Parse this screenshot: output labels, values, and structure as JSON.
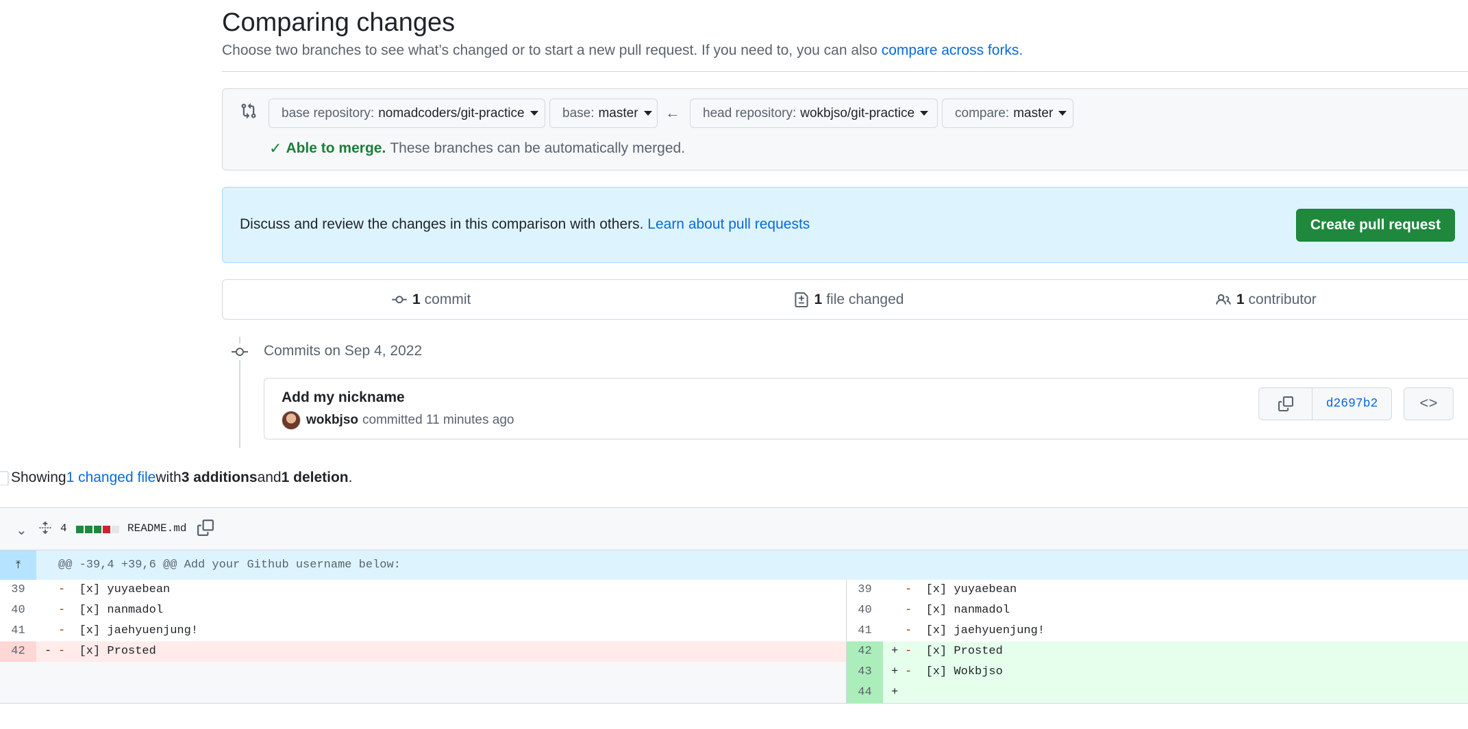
{
  "header": {
    "title": "Comparing changes",
    "subtitle": "Choose two branches to see what’s changed or to start a new pull request. If you need to, you can also ",
    "subtitle_link": "compare across forks",
    "subtitle_end": "."
  },
  "range": {
    "base_repo_label": "base repository:",
    "base_repo_value": "nomadcoders/git-practice",
    "base_label": "base:",
    "base_value": "master",
    "head_repo_label": "head repository:",
    "head_repo_value": "wokbjso/git-practice",
    "compare_label": "compare:",
    "compare_value": "master",
    "merge_ok": "Able to merge.",
    "merge_text": "These branches can be automatically merged."
  },
  "blankslate": {
    "text": "Discuss and review the changes in this comparison with others. ",
    "link": "Learn about pull requests",
    "button": "Create pull request"
  },
  "summary": {
    "commits_count": "1",
    "commits_label": "commit",
    "files_count": "1",
    "files_label": "file changed",
    "contributors_count": "1",
    "contributors_label": "contributor"
  },
  "commits": {
    "group_title": "Commits on Sep 4, 2022",
    "items": [
      {
        "title": "Add my nickname",
        "author": "wokbjso",
        "action": "committed",
        "time": "11 minutes ago",
        "sha": "d2697b2"
      }
    ]
  },
  "diff_summary": {
    "prefix": "Showing ",
    "changed_link": "1 changed file",
    "with": " with ",
    "additions": "3 additions",
    "and": " and ",
    "deletions": "1 deletion",
    "end": "."
  },
  "file": {
    "changes": "4",
    "name": "README.md",
    "diffstat": [
      "add",
      "add",
      "add",
      "del",
      "neutral"
    ],
    "colors": {
      "add": "#1f883d",
      "del": "#cf222e",
      "neutral": "#e6e6e6"
    },
    "hunk": "@@ -39,4 +39,6 @@ Add your Github username below:",
    "rows": [
      {
        "l_num": "39",
        "l_mark": "",
        "l_code": "-  [x] yuyaebean",
        "r_num": "39",
        "r_mark": "",
        "r_code": "-  [x] yuyaebean",
        "type": "ctx"
      },
      {
        "l_num": "40",
        "l_mark": "",
        "l_code": "-  [x] nanmadol",
        "r_num": "40",
        "r_mark": "",
        "r_code": "-  [x] nanmadol",
        "type": "ctx"
      },
      {
        "l_num": "41",
        "l_mark": "",
        "l_code": "-  [x] jaehyuenjung!",
        "r_num": "41",
        "r_mark": "",
        "r_code": "-  [x] jaehyuenjung!",
        "type": "ctx"
      },
      {
        "l_num": "42",
        "l_mark": "-",
        "l_code": "-  [x] Prosted",
        "r_num": "42",
        "r_mark": "+",
        "r_code": "-  [x] Prosted",
        "type": "change"
      },
      {
        "l_num": "",
        "l_mark": "",
        "l_code": "",
        "r_num": "43",
        "r_mark": "+",
        "r_code": "-  [x] Wokbjso",
        "type": "add"
      },
      {
        "l_num": "",
        "l_mark": "",
        "l_code": "",
        "r_num": "44",
        "r_mark": "+",
        "r_code": "",
        "type": "add"
      }
    ]
  }
}
